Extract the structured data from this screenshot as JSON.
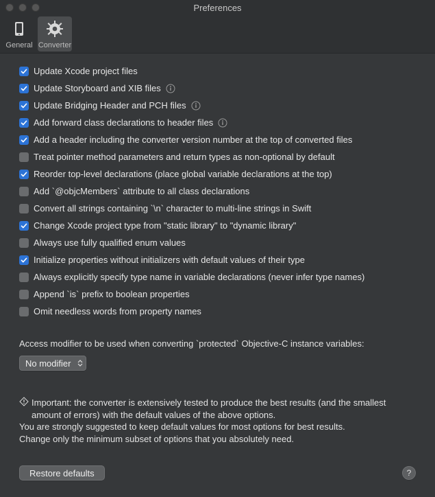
{
  "window": {
    "title": "Preferences"
  },
  "toolbar": {
    "general": "General",
    "converter": "Converter"
  },
  "options": [
    {
      "checked": true,
      "label": "Update Xcode project files",
      "info": false
    },
    {
      "checked": true,
      "label": "Update Storyboard and XIB files",
      "info": true
    },
    {
      "checked": true,
      "label": "Update Bridging Header and PCH files",
      "info": true
    },
    {
      "checked": true,
      "label": "Add forward class declarations to header files",
      "info": true
    },
    {
      "checked": true,
      "label": "Add a header including the converter version number at the top of converted files",
      "info": false
    },
    {
      "checked": false,
      "label": "Treat pointer method parameters and return types as non-optional by default",
      "info": false
    },
    {
      "checked": true,
      "label": "Reorder top-level declarations (place global variable declarations at the top)",
      "info": false
    },
    {
      "checked": false,
      "label": "Add `@objcMembers` attribute to all class declarations",
      "info": false
    },
    {
      "checked": false,
      "label": "Convert all strings containing `\\n` character to multi-line strings in Swift",
      "info": false
    },
    {
      "checked": true,
      "label": "Change Xcode project type from \"static library\" to \"dynamic library\"",
      "info": false
    },
    {
      "checked": false,
      "label": "Always use fully qualified enum values",
      "info": false
    },
    {
      "checked": true,
      "label": "Initialize properties without initializers with default values of their type",
      "info": false
    },
    {
      "checked": false,
      "label": "Always explicitly specify type name in variable declarations (never infer type names)",
      "info": false
    },
    {
      "checked": false,
      "label": "Append `is` prefix to boolean properties",
      "info": false
    },
    {
      "checked": false,
      "label": "Omit needless words from property names",
      "info": false
    }
  ],
  "access_modifier": {
    "label": "Access modifier to be used when converting `protected` Objective-C instance variables:",
    "selected": "No modifier"
  },
  "warning": {
    "line1": "Important: the converter is extensively tested to produce the best results (and the smallest amount of errors) with the default values of the above options.",
    "line2": "You are strongly suggested to keep default values for most options for best results.",
    "line3": "Change only the minimum subset of options that you absolutely need."
  },
  "buttons": {
    "restore": "Restore defaults",
    "help": "?"
  }
}
